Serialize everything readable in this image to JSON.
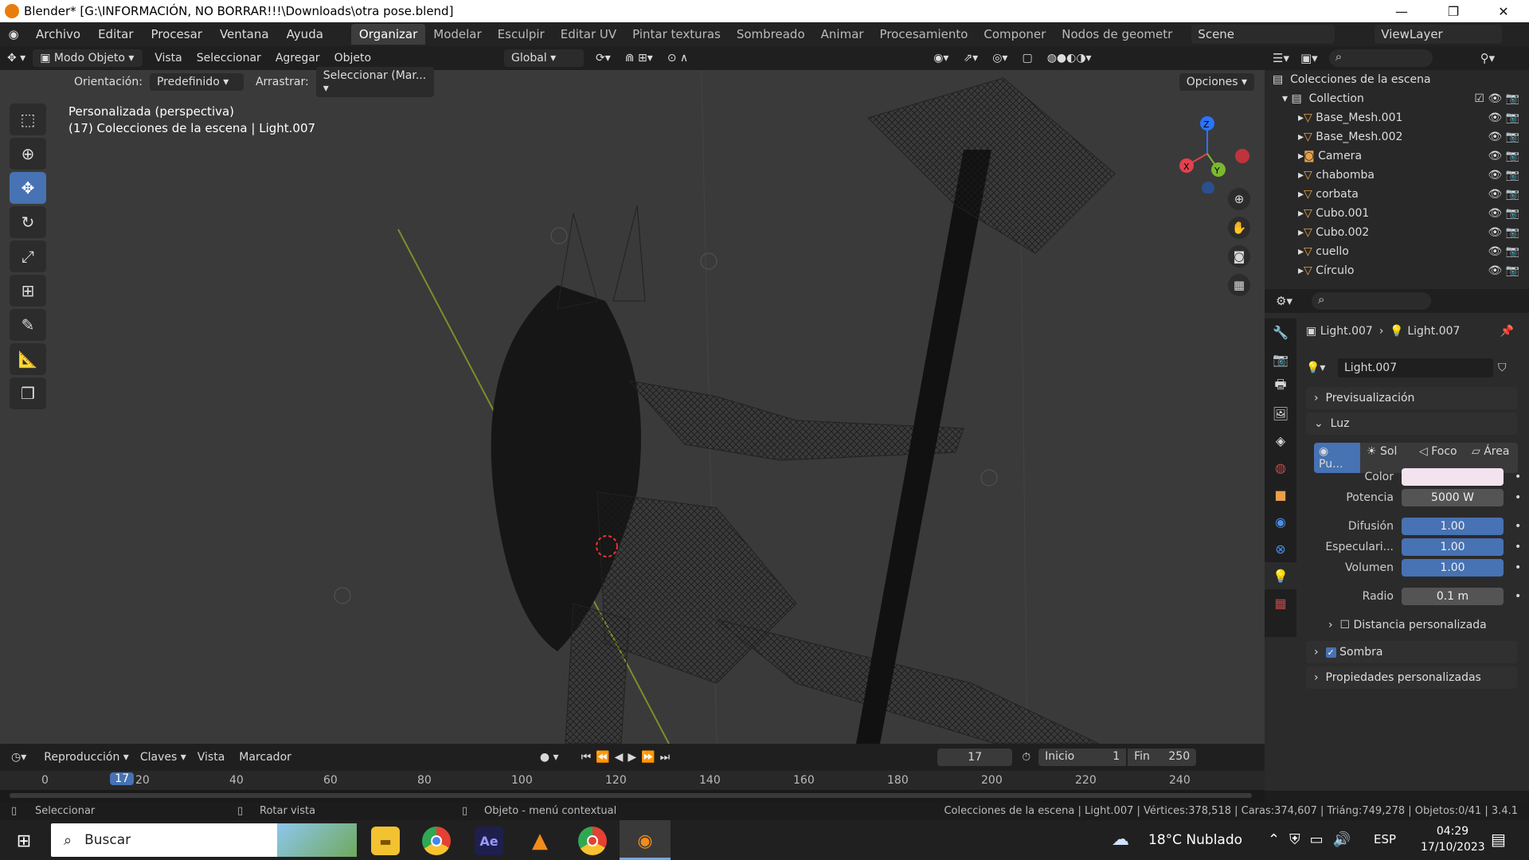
{
  "titlebar": {
    "title": "Blender* [G:\\INFORMACIÓN, NO BORRAR!!!\\Downloads\\otra pose.blend]",
    "min": "—",
    "restore": "❐",
    "close": "✕"
  },
  "menus": [
    "Archivo",
    "Editar",
    "Procesar",
    "Ventana",
    "Ayuda"
  ],
  "workspaces": [
    "Organizar",
    "Modelar",
    "Esculpir",
    "Editar UV",
    "Pintar texturas",
    "Sombreado",
    "Animar",
    "Procesamiento",
    "Componer",
    "Nodos de geometr"
  ],
  "scene": "Scene",
  "viewlayer": "ViewLayer",
  "header3d": {
    "mode": "Modo Objeto",
    "items": [
      "Vista",
      "Seleccionar",
      "Agregar",
      "Objeto"
    ],
    "orient_global": "Global"
  },
  "header3d2": {
    "orient_label": "Orientación:",
    "orient_value": "Predefinido",
    "drag_label": "Arrastrar:",
    "drag_value": "Seleccionar (Mar...",
    "options": "Opciones"
  },
  "viewport": {
    "line1": "Personalizada (perspectiva)",
    "line2": "(17) Colecciones de la escena | Light.007"
  },
  "outliner": {
    "title": "Colecciones de la escena",
    "collection": "Collection",
    "items": [
      "Base_Mesh.001",
      "Base_Mesh.002",
      "Camera",
      "chabomba",
      "corbata",
      "Cubo.001",
      "Cubo.002",
      "cuello",
      "Círculo"
    ]
  },
  "props": {
    "breadcrumb1": "Light.007",
    "breadcrumb2": "Light.007",
    "datablock": "Light.007",
    "preview": "Previsualización",
    "luz": "Luz",
    "types": [
      "Pu...",
      "Sol",
      "Foco",
      "Área"
    ],
    "color_label": "Color",
    "power_label": "Potencia",
    "power": "5000 W",
    "diff_label": "Difusión",
    "diff": "1.00",
    "spec_label": "Especulari...",
    "spec": "1.00",
    "vol_label": "Volumen",
    "vol": "1.00",
    "radius_label": "Radio",
    "radius": "0.1 m",
    "custom_dist": "Distancia personalizada",
    "shadow": "Sombra",
    "custom_props": "Propiedades personalizadas",
    "light_color": "#f3e3ef"
  },
  "timeline": {
    "menus": [
      "Reproducción",
      "Claves",
      "Vista",
      "Marcador"
    ],
    "frame": "17",
    "start_label": "Inicio",
    "start": "1",
    "end_label": "Fin",
    "end": "250",
    "ticks": [
      "0",
      "20",
      "40",
      "60",
      "80",
      "100",
      "120",
      "140",
      "160",
      "180",
      "200",
      "220",
      "240"
    ],
    "current": "17"
  },
  "status": {
    "left1": "Seleccionar",
    "left2": "Rotar vista",
    "left3": "Objeto - menú contextual",
    "right": "Colecciones de la escena | Light.007 | Vértices:378,518 | Caras:374,607 | Triáng:749,278 | Objetos:0/41 | 3.4.1"
  },
  "taskbar": {
    "search": "Buscar",
    "weather": "18°C  Nublado",
    "lang": "ESP",
    "time": "04:29",
    "date": "17/10/2023"
  }
}
